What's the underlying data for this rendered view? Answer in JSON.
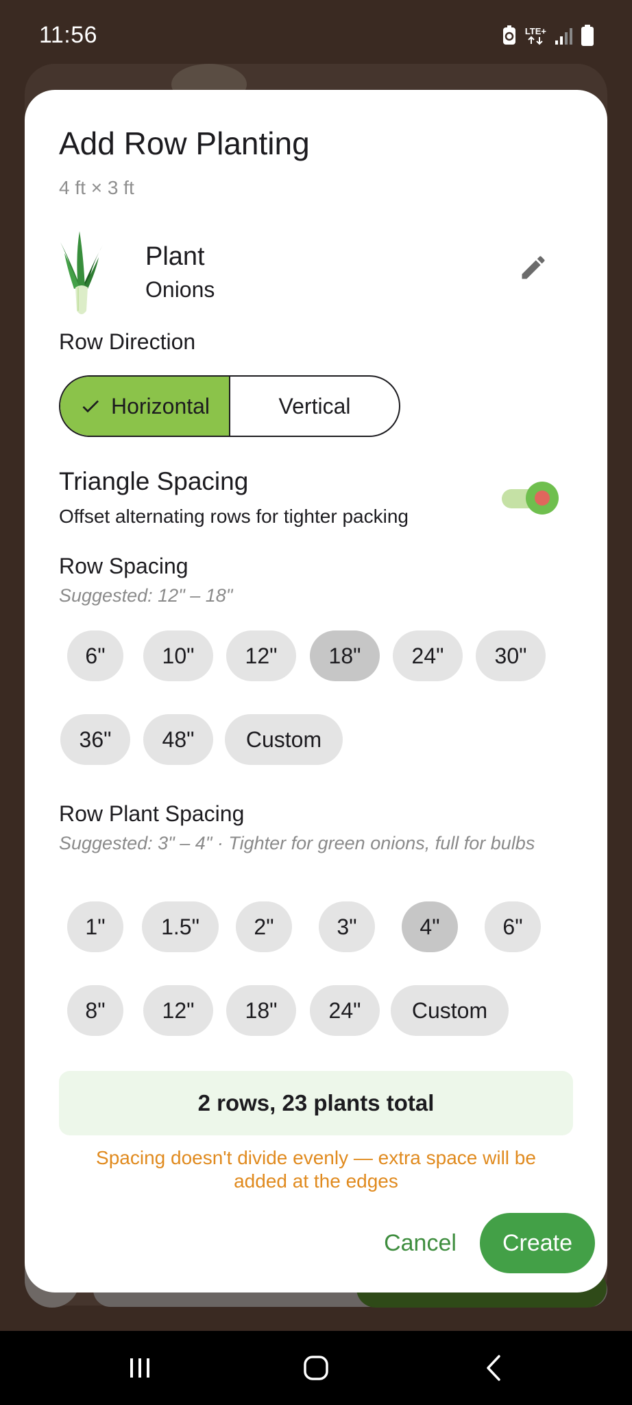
{
  "status_bar": {
    "time": "11:56",
    "network_label": "LTE+",
    "icons": [
      "data-saver-icon",
      "lte-signal-icon",
      "signal-bars-icon",
      "battery-icon"
    ]
  },
  "dialog": {
    "title": "Add Row Planting",
    "subtitle": "4 ft × 3 ft",
    "plant": {
      "label": "Plant",
      "value": "Onions",
      "image_icon": "leek-icon",
      "edit_icon": "pencil-icon"
    },
    "row_direction": {
      "label": "Row Direction",
      "options": [
        "Horizontal",
        "Vertical"
      ],
      "selected": "Horizontal",
      "check_icon": "check-icon"
    },
    "triangle_spacing": {
      "label": "Triangle Spacing",
      "description": "Offset alternating rows for tighter packing",
      "enabled": true
    },
    "row_spacing": {
      "label": "Row Spacing",
      "hint": "Suggested: 12\" – 18\"",
      "options": [
        "6\"",
        "10\"",
        "12\"",
        "18\"",
        "24\"",
        "30\"",
        "36\"",
        "48\"",
        "Custom"
      ],
      "selected": "18\""
    },
    "row_plant_spacing": {
      "label": "Row Plant Spacing",
      "hint": "Suggested: 3\" – 4\" · Tighter for green onions, full for bulbs",
      "options": [
        "1\"",
        "1.5\"",
        "2\"",
        "3\"",
        "4\"",
        "6\"",
        "8\"",
        "12\"",
        "18\"",
        "24\"",
        "Custom"
      ],
      "selected": "4\""
    },
    "summary": "2 rows, 23 plants total",
    "warning": "Spacing doesn't divide evenly — extra space will be added at the edges",
    "cancel_label": "Cancel",
    "create_label": "Create"
  },
  "colors": {
    "accent_green": "#43a047",
    "selected_segment": "#8bc34a",
    "warning": "#e08a1e",
    "summary_bg": "#edf7ea"
  },
  "nav_bar": {
    "buttons": [
      "recents-icon",
      "home-icon",
      "back-icon"
    ]
  }
}
